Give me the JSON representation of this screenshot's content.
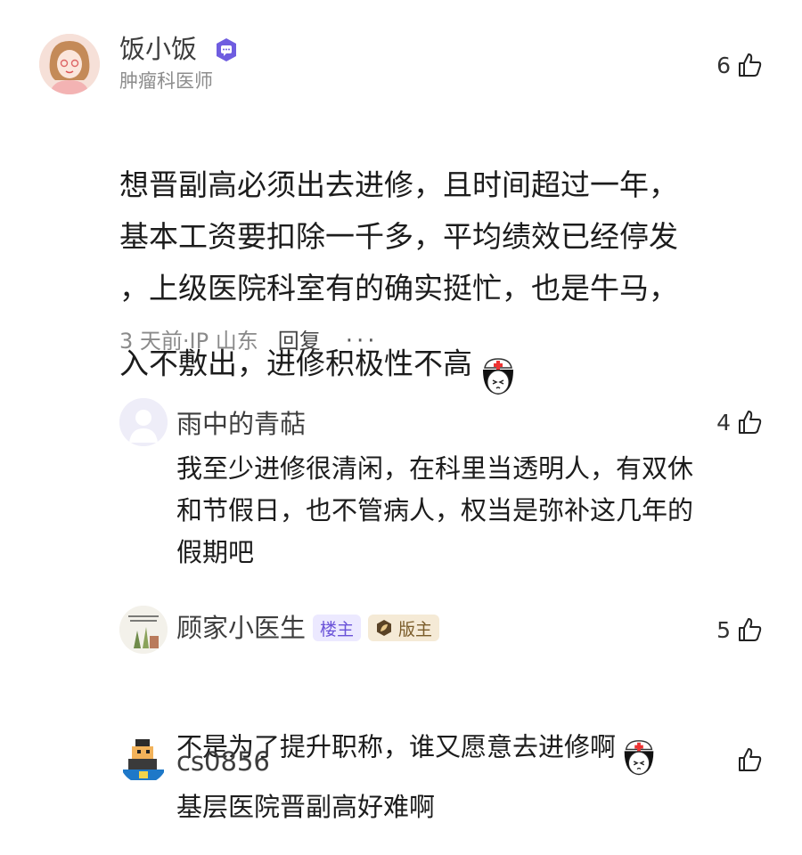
{
  "comment": {
    "author": "饭小饭",
    "title": "肿瘤科医师",
    "likes": "6",
    "text": "想晋副高必须出去进修，且时间超过一年，\n基本工资要扣除一千多，平均绩效已经停发\n，上级医院科室有的确实挺忙，也是牛马，\n入不敷出，进修积极性不高",
    "time": "3 天前·IP 山东",
    "reply_label": "回复",
    "more": "···"
  },
  "replies": [
    {
      "author": "雨中的青萜",
      "likes": "4",
      "text": "我至少进修很清闲，在科里当透明人，有双休\n和节假日，也不管病人，权当是弥补这几年的\n假期吧"
    },
    {
      "author": "顾家小医生",
      "badge_owner": "楼主",
      "badge_mod": "版主",
      "likes": "5",
      "text": "不是为了提升职称，谁又愿意去进修啊"
    },
    {
      "author": "cs0856",
      "likes": "",
      "text": "基层医院晋副高好难啊"
    }
  ],
  "icons": {
    "like": "thumbs-up-icon",
    "verified": "verified-chat-badge-icon",
    "sticker": "nurse-sticker-icon"
  },
  "colors": {
    "badge_purple": "#6a52d8",
    "badge_gold": "#7a5c2a",
    "muted": "#8a8a8a"
  }
}
